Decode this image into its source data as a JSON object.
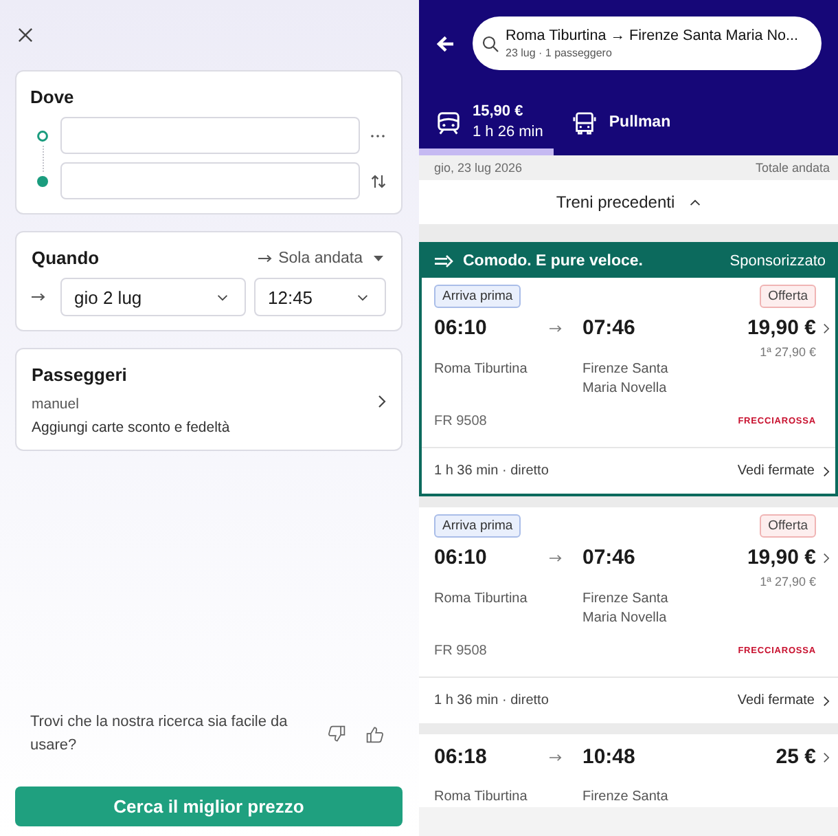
{
  "search_form": {
    "where": {
      "title": "Dove",
      "stops": [
        {
          "kind": "origin"
        },
        {
          "kind": "destination"
        }
      ]
    },
    "when": {
      "title": "Quando",
      "trip_type": "Sola andata",
      "date": "gio 2 lug",
      "time": "12:45"
    },
    "passengers": {
      "title": "Passeggeri",
      "traveller": "manuel",
      "discount_cards": "Aggiungi carte sconto e fedeltà"
    },
    "feedback": {
      "question": "Trovi che la nostra ricerca sia facile da usare?"
    },
    "submit_button": "Cerca il miglior prezzo"
  },
  "results": {
    "search": {
      "route": "Roma Tiburtina → Firenze Santa Maria No...",
      "details": "23 lug · 1 passeggero"
    },
    "tabs": [
      {
        "kind": "train",
        "price": "15,90 €",
        "duration": "1 h 26 min",
        "selected": true
      },
      {
        "kind": "bus",
        "label": "Pullman",
        "selected": false
      }
    ],
    "date_bar": {
      "date": "gio, 23 lug 2026",
      "total": "Totale andata"
    },
    "earlier_button": "Treni precedenti",
    "trains": [
      {
        "banner": {
          "title": "Comodo. E pure veloce.",
          "label": "Sponsorizzato"
        },
        "badges": [
          {
            "kind": "highlight",
            "text": "Arriva prima"
          },
          {
            "kind": "offer",
            "text": "Offerta"
          }
        ],
        "departure": "06:10",
        "arrival": "07:46",
        "price": "19,90 €",
        "first_class_price": "1ª 27,90 €",
        "origin": "Roma Tiburtina",
        "destination": "Firenze Santa Maria Novella",
        "train_number": "FR 9508",
        "operator": "FRECCIAROSSA",
        "duration": "1 h 36 min · diretto",
        "stops_link": "Vedi fermate"
      },
      {
        "badges": [
          {
            "kind": "highlight",
            "text": "Arriva prima"
          },
          {
            "kind": "offer",
            "text": "Offerta"
          }
        ],
        "departure": "06:10",
        "arrival": "07:46",
        "price": "19,90 €",
        "first_class_price": "1ª 27,90 €",
        "origin": "Roma Tiburtina",
        "destination": "Firenze Santa Maria Novella",
        "train_number": "FR 9508",
        "operator": "FRECCIAROSSA",
        "duration": "1 h 36 min · diretto",
        "stops_link": "Vedi fermate"
      },
      {
        "departure": "06:18",
        "arrival": "10:48",
        "price": "25 €",
        "origin": "Roma Tiburtina",
        "destination": "Firenze Santa"
      }
    ]
  }
}
